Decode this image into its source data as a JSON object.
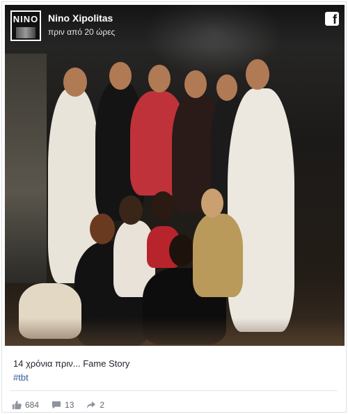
{
  "post": {
    "author": "Nino Xipolitas",
    "timestamp": "πριν από 20 ώρες",
    "avatar_text": "NINO",
    "caption": "14 χρόνια πριν... Fame Story",
    "hashtag": "#tbt",
    "platform_icon": "facebook-icon"
  },
  "stats": {
    "likes": "684",
    "comments": "13",
    "shares": "2"
  },
  "colors": {
    "link": "#365899",
    "text": "#1d2129",
    "muted": "#606770"
  }
}
